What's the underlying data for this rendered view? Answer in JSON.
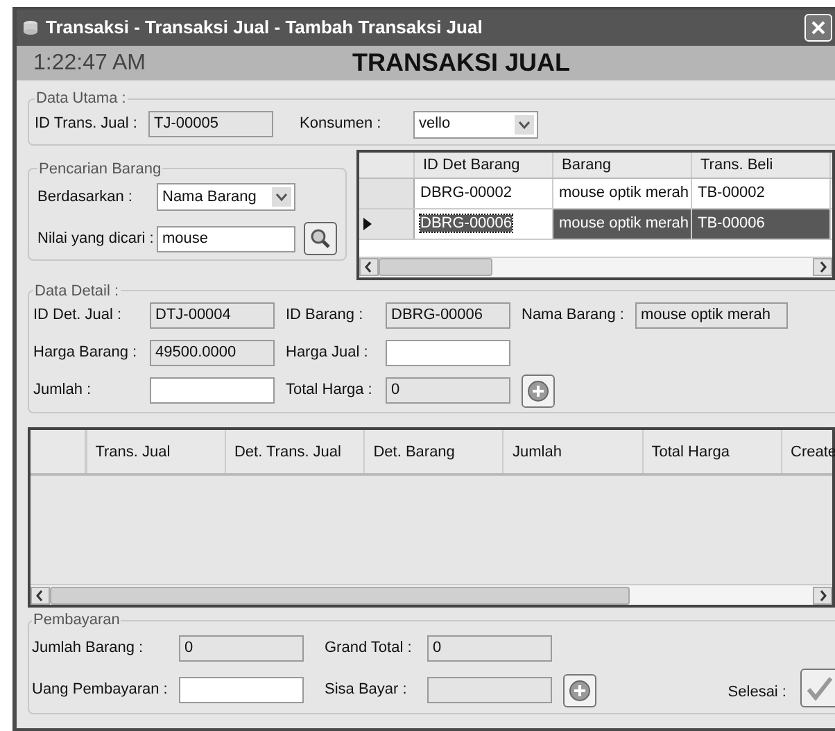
{
  "window": {
    "title": "Transaksi - Transaksi Jual - Tambah Transaksi Jual"
  },
  "header": {
    "time": "1:22:47 AM",
    "title": "TRANSAKSI JUAL"
  },
  "data_utama": {
    "legend": "Data Utama :",
    "id_label": "ID Trans. Jual :",
    "id_value": "TJ-00005",
    "konsumen_label": "Konsumen :",
    "konsumen_value": "vello"
  },
  "pencarian": {
    "legend": "Pencarian Barang",
    "by_label": "Berdasarkan :",
    "by_value": "Nama Barang",
    "search_label": "Nilai yang dicari :",
    "search_value": "mouse"
  },
  "barang_grid": {
    "columns": [
      "ID Det Barang",
      "Barang",
      "Trans. Beli"
    ],
    "rows": [
      {
        "selected": false,
        "cells": [
          "DBRG-00002",
          "mouse optik merah",
          "TB-00002"
        ]
      },
      {
        "selected": true,
        "cells": [
          "DBRG-00006",
          "mouse optik merah",
          "TB-00006"
        ]
      }
    ]
  },
  "data_detail": {
    "legend": "Data Detail :",
    "rows": [
      [
        {
          "label": "ID Det. Jual :",
          "value": "DTJ-00004",
          "kind": "readonly"
        },
        {
          "label": "ID Barang :",
          "value": "DBRG-00006",
          "kind": "readonly"
        },
        {
          "label": "Nama Barang :",
          "value": "mouse optik merah",
          "kind": "readonly"
        }
      ],
      [
        {
          "label": "Harga Barang :",
          "value": "49500.0000",
          "kind": "readonly"
        },
        {
          "label": "Harga Jual :",
          "kind": "input"
        }
      ],
      [
        {
          "label": "Jumlah :",
          "kind": "input"
        },
        {
          "label": "Total Harga :",
          "value": "0",
          "kind": "readonly"
        }
      ]
    ]
  },
  "detail_grid": {
    "columns": [
      "Trans. Jual",
      "Det. Trans. Jual",
      "Det. Barang",
      "Jumlah",
      "Total Harga",
      "Create"
    ]
  },
  "pembayaran": {
    "legend": "Pembayaran",
    "rows": [
      [
        {
          "label": "Jumlah Barang :",
          "value": "0",
          "kind": "readonly"
        },
        {
          "label": "Grand Total :",
          "value": "0",
          "kind": "readonly"
        }
      ],
      [
        {
          "label": "Uang Pembayaran :",
          "kind": "input"
        },
        {
          "label": "Sisa Bayar :",
          "kind": "readonly"
        }
      ]
    ],
    "selesai_label": "Selesai :"
  }
}
